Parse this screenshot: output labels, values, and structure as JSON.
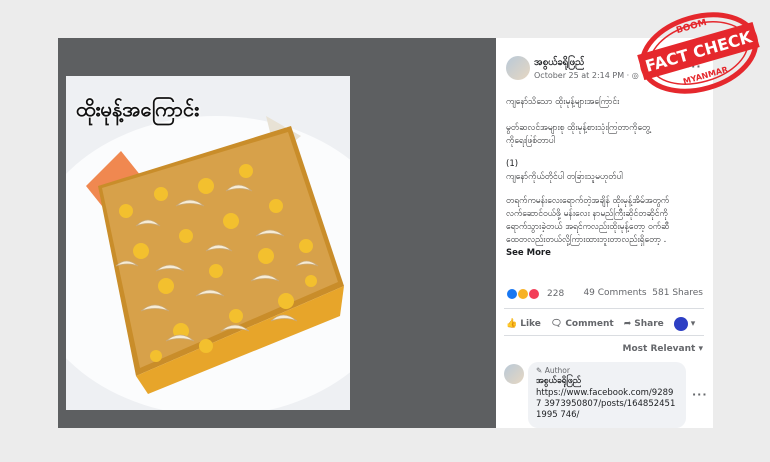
{
  "image": {
    "overlay_title": "ထိုးမုန့်အကြောင်း"
  },
  "post": {
    "page_name": "အစွယ်ခရိုဖြည်",
    "timestamp": "October 25 at 2:14 PM ·",
    "lines": [
      "ကျနော်သိသော ထိုးမုန့်များအကြောင်း",
      "မွတ်ဆလင်အများစု ထိုးမုန့်စားသုံးကြတာကိုတွေ့",
      "ကိုရေးဖြစ်တာပါ",
      "(1)",
      "ကျနော်ကိုယ်တိုင်ပါ တခြားသူမဟုတ်ပါ",
      "တရက်ကမန်းလေးရောက်တဲ့အချိန် ထိုးမုန့်အိမ်အတွက်",
      "လက်ဆောင်ဝယ်ဖို့ မန်းလေး နာမည်ကြီးဆိုင်တဆိုင်ကို",
      "ရောက်သွားခဲ့တယ် အရင်ကလည်းထိုးမုန့်တော့ ဝက်ဆီ",
      "ထေတလည်းတယ်လို့ကြားထားဘူးတာလည်းရှိတော့ ..."
    ],
    "see_more": "See More",
    "reactions_count": "228",
    "comments_count": "49 Comments",
    "shares_count": "581 Shares",
    "actions": {
      "like": "Like",
      "comment": "Comment",
      "share": "Share"
    },
    "sort_label": "Most Relevant",
    "comment": {
      "author_tag": "Author",
      "name": "အစွယ်ခရိုဖြည်",
      "text": "https://www.facebook.com/92897 3973950807/posts/1648524511995 746/"
    }
  },
  "stamp": {
    "top": "BOOM",
    "main": "FACT CHECK",
    "bottom": "MYANMAR"
  },
  "colors": {
    "accent": "#1877f2",
    "stamp_red": "#e5282d",
    "like_blue": "#1877f2",
    "wow_yellow": "#f7b125",
    "love_red": "#f33e58"
  }
}
